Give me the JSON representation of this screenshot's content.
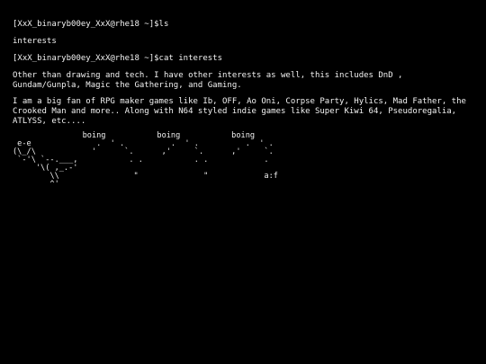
{
  "terminal": {
    "prompt1": "[XxX_binaryb00ey_XxX@rhe18 ~]$ls",
    "ls_output": "interests",
    "prompt2": "[XxX_binaryb00ey_XxX@rhe18 ~]$cat interests",
    "paragraph1": "Other than drawing and tech. I have other interests as well, this includes DnD , Gundam/Gunpla, Magic the Gathering, and Gaming.",
    "paragraph2": "I am a big fan of RPG maker games like Ib, OFF, Ao Oni, Corpse Party, Hylics, Mad Father, the Crooked Man and more.. Along with N64 styled indie games like Super Kiwi 64, Pseudoregalia, ATLYSS, etc....",
    "ascii_art": "               boing           boing           boing\n e-e              .  ' .          .  ' .          .  ' .\n(\\_/\\            '      `.      ,'     `.      ,'     `.\n `-'\\ `--.___,           . .           . .            .\n     '\\( ,_.-'\n        \\\\                \"              \"            a:f\n        ^'"
  }
}
